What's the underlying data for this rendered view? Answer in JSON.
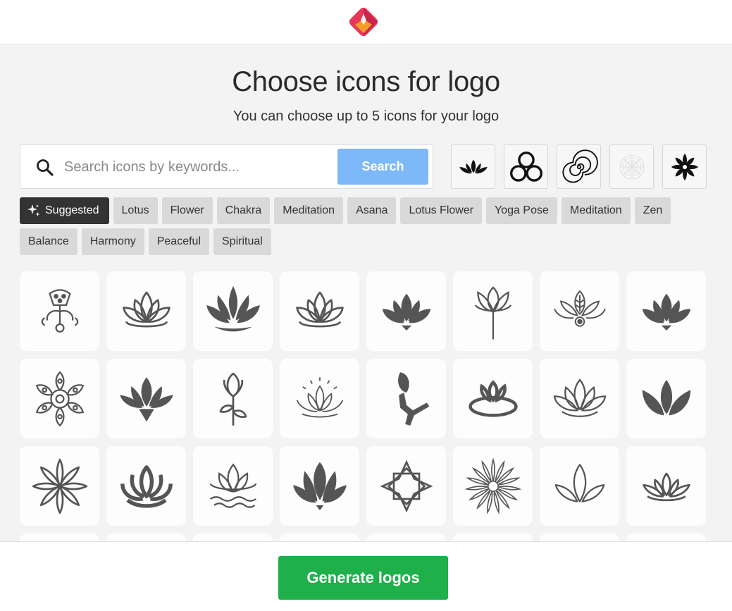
{
  "header": {
    "logo_icon": "brand-diamond-icon",
    "brand_colors": [
      "#e8375a",
      "#f39c2b",
      "#c7254e"
    ]
  },
  "main": {
    "title": "Choose icons for logo",
    "subtitle": "You can choose up to 5 icons for your logo"
  },
  "search": {
    "placeholder": "Search icons by keywords...",
    "value": "",
    "button_label": "Search",
    "button_color": "#7db8f9"
  },
  "selected_icons": [
    "lotus-icon",
    "three-circles-icon",
    "spiral-icon",
    "mandala-icon",
    "floral-star-icon"
  ],
  "tags": {
    "suggested_label": "Suggested",
    "items": [
      "Lotus",
      "Flower",
      "Chakra",
      "Meditation",
      "Asana",
      "Lotus Flower",
      "Yoga Pose",
      "Meditation",
      "Zen",
      "Balance",
      "Harmony",
      "Peaceful",
      "Spiritual"
    ]
  },
  "icon_grid": [
    "lotus-pod-ornament-icon",
    "lotus-outline-icon",
    "lotus-flame-icon",
    "lotus-outline-icon",
    "lotus-solid-icon",
    "lotus-stem-icon",
    "lotus-chakra-icon",
    "lotus-solid-icon",
    "mandala-icon",
    "lotus-solid-icon",
    "lotus-bud-stem-icon",
    "lotus-rays-icon",
    "lotus-bud-branch-icon",
    "lotus-ring-icon",
    "lotus-outline-icon",
    "lotus-petals-icon",
    "star-flower-icon",
    "lotus-bold-outline-icon",
    "lotus-water-icon",
    "lotus-solid-icon",
    "geometric-flower-icon",
    "sunflower-mandala-icon",
    "lotus-line-icon",
    "lotus-layered-icon"
  ],
  "footer": {
    "generate_label": "Generate logos",
    "generate_color": "#1faf4b"
  }
}
